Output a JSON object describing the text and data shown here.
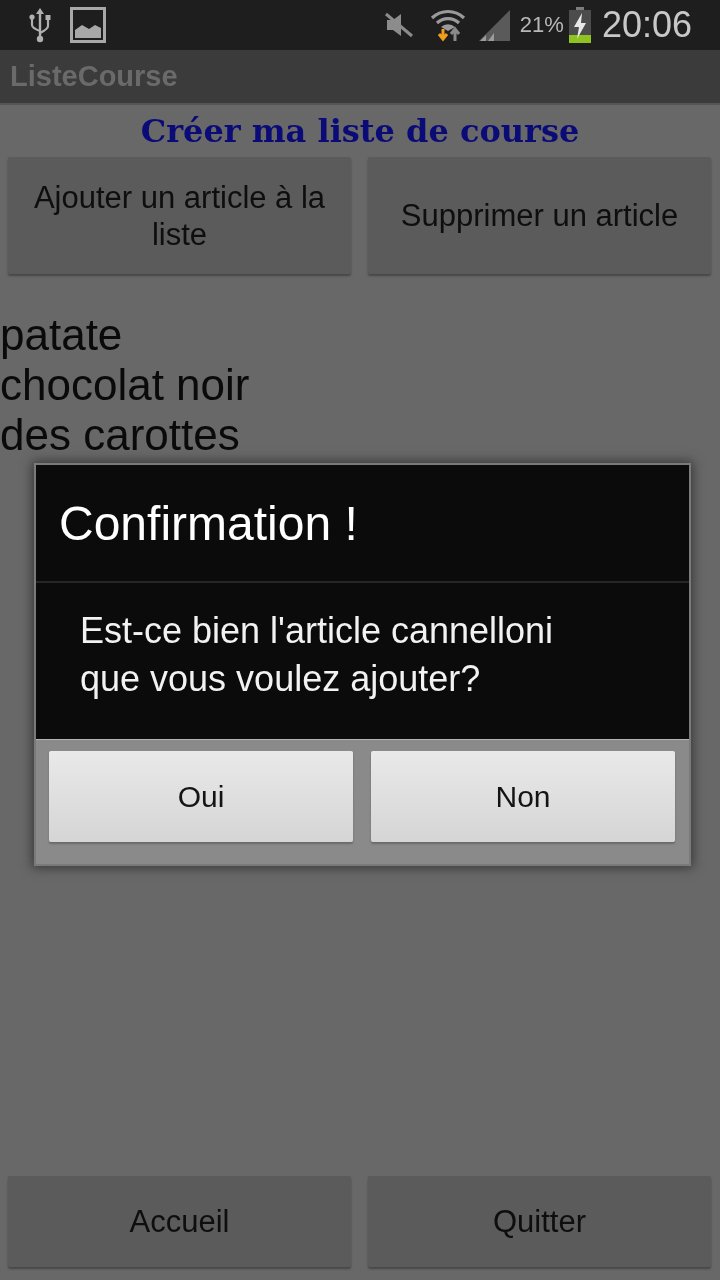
{
  "status_bar": {
    "battery_percent": "21%",
    "time": "20:06"
  },
  "action_bar": {
    "title": "ListeCourse"
  },
  "heading": "Créer ma liste de course",
  "top_buttons": [
    {
      "label": "Ajouter un article à la liste"
    },
    {
      "label": "Supprimer un article"
    }
  ],
  "items": [
    "patate",
    "chocolat noir",
    "des carottes"
  ],
  "dialog": {
    "title": "Confirmation !",
    "message": "Est-ce bien l'article cannelloni que vous voulez ajouter?",
    "buttons": [
      {
        "label": "Oui"
      },
      {
        "label": "Non"
      }
    ]
  },
  "bottom_buttons": [
    {
      "label": "Accueil"
    },
    {
      "label": "Quitter"
    }
  ]
}
